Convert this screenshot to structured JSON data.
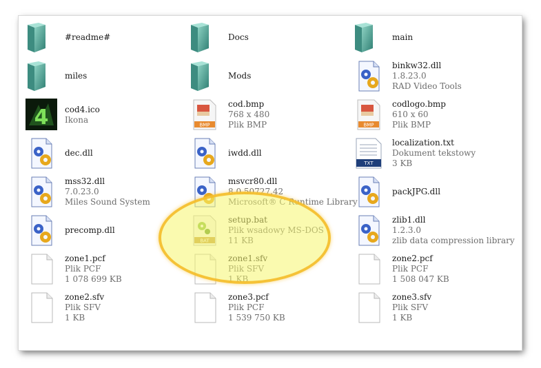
{
  "files": [
    {
      "name": "#readme#",
      "kind": "folder",
      "details": []
    },
    {
      "name": "Docs",
      "kind": "folder",
      "details": []
    },
    {
      "name": "main",
      "kind": "folder",
      "details": []
    },
    {
      "name": "miles",
      "kind": "folder",
      "details": []
    },
    {
      "name": "Mods",
      "kind": "folder",
      "details": []
    },
    {
      "name": "binkw32.dll",
      "kind": "dll",
      "details": [
        "1.8.23.0",
        "RAD Video Tools"
      ]
    },
    {
      "name": "cod4.ico",
      "kind": "ico",
      "details": [
        "Ikona"
      ]
    },
    {
      "name": "cod.bmp",
      "kind": "bmp",
      "details": [
        "768 x 480",
        "Plik BMP"
      ]
    },
    {
      "name": "codlogo.bmp",
      "kind": "bmp",
      "details": [
        "610 x 60",
        "Plik BMP"
      ]
    },
    {
      "name": "dec.dll",
      "kind": "dll",
      "details": []
    },
    {
      "name": "iwdd.dll",
      "kind": "dll",
      "details": []
    },
    {
      "name": "localization.txt",
      "kind": "txt",
      "details": [
        "Dokument tekstowy",
        "3 KB"
      ]
    },
    {
      "name": "mss32.dll",
      "kind": "dll",
      "details": [
        "7.0.23.0",
        "Miles Sound System"
      ]
    },
    {
      "name": "msvcr80.dll",
      "kind": "dll",
      "details": [
        "8.0.50727.42",
        "Microsoft® C Runtime Library"
      ]
    },
    {
      "name": "packJPG.dll",
      "kind": "dll",
      "details": []
    },
    {
      "name": "precomp.dll",
      "kind": "dll",
      "details": []
    },
    {
      "name": "setup.bat",
      "kind": "bat",
      "details": [
        "Plik wsadowy MS-DOS",
        "11 KB"
      ]
    },
    {
      "name": "zlib1.dll",
      "kind": "dll",
      "details": [
        "1.2.3.0",
        "zlib data compression library"
      ]
    },
    {
      "name": "zone1.pcf",
      "kind": "blank",
      "details": [
        "Plik PCF",
        "1 078 699 KB"
      ]
    },
    {
      "name": "zone1.sfv",
      "kind": "blank",
      "details": [
        "Plik SFV",
        "1 KB"
      ]
    },
    {
      "name": "zone2.pcf",
      "kind": "blank",
      "details": [
        "Plik PCF",
        "1 508 047 KB"
      ]
    },
    {
      "name": "zone2.sfv",
      "kind": "blank",
      "details": [
        "Plik SFV",
        "1 KB"
      ]
    },
    {
      "name": "zone3.pcf",
      "kind": "blank",
      "details": [
        "Plik PCF",
        "1 539 750 KB"
      ]
    },
    {
      "name": "zone3.sfv",
      "kind": "blank",
      "details": [
        "Plik SFV",
        "1 KB"
      ]
    }
  ],
  "icon_labels": {
    "bmp": "BMP",
    "txt": "TXT",
    "bat": "BAT"
  },
  "colors": {
    "highlight_fill": "#f6f66e",
    "highlight_border": "#f5bc2a",
    "folder": "#5aa89a"
  }
}
